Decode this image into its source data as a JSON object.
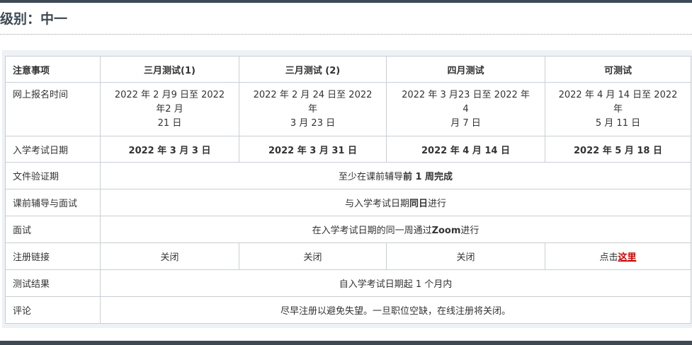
{
  "level_title": "级别：中一",
  "table": {
    "headers": [
      "注意事项",
      "三月测试(1)",
      "三月测试 (2)",
      "四月测试",
      "可测试"
    ],
    "online_registration": {
      "label": "网上报名时间",
      "values": [
        [
          "2022 年 2 月9 日至 2022",
          "年2 月",
          "21 日"
        ],
        [
          "2022 年 2 月 24 日至 2022",
          "年",
          "3 月 23 日"
        ],
        [
          "2022 年 3 月23 日至 2022 年",
          "4",
          "月 7 日"
        ],
        [
          "2022 年 4 月 14 日至 2022",
          "年",
          "5 月 11 日"
        ]
      ]
    },
    "exam_date": {
      "label": "入学考试日期",
      "values": [
        "2022 年 3 月 3 日",
        "2022 年 3 月 31 日",
        "2022 年 4 月 14 日",
        "2022 年 5 月 18 日"
      ]
    },
    "document_verification": {
      "label": "文件验证期",
      "prefix": "至少在课前辅导",
      "bold": "前 1 周完成"
    },
    "tutoring_interview": {
      "label": "课前辅导与面试",
      "prefix": "与入学考试日期",
      "bold": "同日",
      "suffix": "进行"
    },
    "interview": {
      "label": "面试",
      "prefix": "在入学考试日期的同一周通过",
      "bold": "Zoom",
      "suffix": "进行"
    },
    "registration_link": {
      "label": "注册链接",
      "closed": [
        "关闭",
        "关闭",
        "关闭"
      ],
      "open_prefix": "点击",
      "open_link": "这里"
    },
    "test_result": {
      "label": "测试结果",
      "value": "自入学考试日期起 1 个月内"
    },
    "comment": {
      "label": "评论",
      "value": "尽早注册以避免失望。一旦职位空缺，在线注册将关闭。"
    }
  },
  "colors": {
    "bar": "#3d4a55",
    "link": "#cc0000",
    "border": "#c9ced5",
    "panel": "#eef1f5"
  }
}
